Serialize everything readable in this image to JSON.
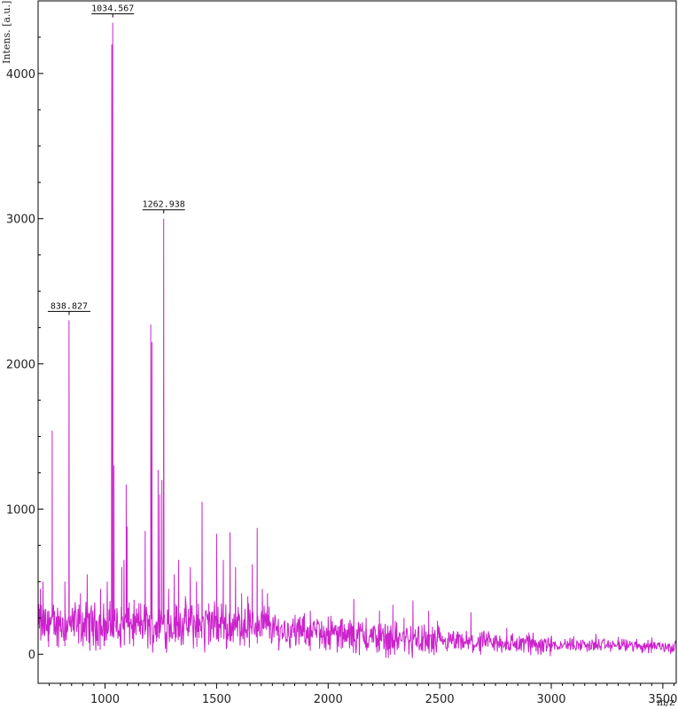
{
  "chart_data": {
    "type": "line",
    "ylabel": "Intens. [a.u.]",
    "xlabel": "m/z",
    "xlim": [
      700,
      3560
    ],
    "ylim": [
      -200,
      4500
    ],
    "x_ticks": [
      1000,
      1500,
      2000,
      2500,
      3000,
      3500
    ],
    "x_tick_labels": [
      "1000",
      "1500",
      "2000",
      "2500",
      "3000",
      "3500"
    ],
    "y_ticks": [
      0,
      1000,
      2000,
      3000,
      4000
    ],
    "y_tick_labels": [
      "0",
      "1000",
      "2000",
      "3000",
      "4000"
    ],
    "grid": false,
    "legend": "none",
    "series_color": "#cc22cc",
    "annotations": [
      {
        "x": 838.827,
        "y": 2300,
        "text": "838.827"
      },
      {
        "x": 1034.567,
        "y": 4350,
        "text": "1034.567"
      },
      {
        "x": 1262.938,
        "y": 3000,
        "text": "1262.938"
      }
    ],
    "peaks": [
      {
        "x": 710,
        "y": 450
      },
      {
        "x": 722,
        "y": 500
      },
      {
        "x": 748,
        "y": 300
      },
      {
        "x": 763,
        "y": 1540
      },
      {
        "x": 800,
        "y": 300
      },
      {
        "x": 820,
        "y": 500
      },
      {
        "x": 838.827,
        "y": 2300
      },
      {
        "x": 860,
        "y": 300
      },
      {
        "x": 890,
        "y": 420
      },
      {
        "x": 920,
        "y": 550
      },
      {
        "x": 945,
        "y": 300
      },
      {
        "x": 980,
        "y": 450
      },
      {
        "x": 1010,
        "y": 500
      },
      {
        "x": 1030,
        "y": 4200
      },
      {
        "x": 1034.567,
        "y": 4350
      },
      {
        "x": 1040,
        "y": 1300
      },
      {
        "x": 1075,
        "y": 600
      },
      {
        "x": 1085,
        "y": 650
      },
      {
        "x": 1095,
        "y": 1170
      },
      {
        "x": 1099,
        "y": 880
      },
      {
        "x": 1130,
        "y": 350
      },
      {
        "x": 1160,
        "y": 350
      },
      {
        "x": 1180,
        "y": 850
      },
      {
        "x": 1205,
        "y": 2270
      },
      {
        "x": 1210,
        "y": 2150
      },
      {
        "x": 1238,
        "y": 1270
      },
      {
        "x": 1245,
        "y": 1100
      },
      {
        "x": 1255,
        "y": 1200
      },
      {
        "x": 1262.938,
        "y": 3000
      },
      {
        "x": 1285,
        "y": 450
      },
      {
        "x": 1310,
        "y": 550
      },
      {
        "x": 1330,
        "y": 650
      },
      {
        "x": 1360,
        "y": 400
      },
      {
        "x": 1382,
        "y": 600
      },
      {
        "x": 1410,
        "y": 500
      },
      {
        "x": 1435,
        "y": 1050
      },
      {
        "x": 1465,
        "y": 350
      },
      {
        "x": 1500,
        "y": 830
      },
      {
        "x": 1530,
        "y": 650
      },
      {
        "x": 1560,
        "y": 840
      },
      {
        "x": 1585,
        "y": 600
      },
      {
        "x": 1612,
        "y": 420
      },
      {
        "x": 1640,
        "y": 400
      },
      {
        "x": 1660,
        "y": 620
      },
      {
        "x": 1682,
        "y": 870
      },
      {
        "x": 1705,
        "y": 450
      },
      {
        "x": 1728,
        "y": 420
      },
      {
        "x": 1860,
        "y": 200
      },
      {
        "x": 1920,
        "y": 300
      },
      {
        "x": 2000,
        "y": 260
      },
      {
        "x": 2060,
        "y": 220
      },
      {
        "x": 2115,
        "y": 380
      },
      {
        "x": 2170,
        "y": 250
      },
      {
        "x": 2230,
        "y": 300
      },
      {
        "x": 2290,
        "y": 340
      },
      {
        "x": 2340,
        "y": 250
      },
      {
        "x": 2380,
        "y": 370
      },
      {
        "x": 2420,
        "y": 200
      },
      {
        "x": 2450,
        "y": 300
      },
      {
        "x": 2490,
        "y": 230
      },
      {
        "x": 2560,
        "y": 160
      },
      {
        "x": 2640,
        "y": 290
      },
      {
        "x": 2720,
        "y": 150
      },
      {
        "x": 2800,
        "y": 180
      },
      {
        "x": 2900,
        "y": 150
      },
      {
        "x": 3000,
        "y": 120
      },
      {
        "x": 3100,
        "y": 90
      },
      {
        "x": 3200,
        "y": 140
      },
      {
        "x": 3300,
        "y": 90
      },
      {
        "x": 3450,
        "y": 70
      }
    ]
  }
}
